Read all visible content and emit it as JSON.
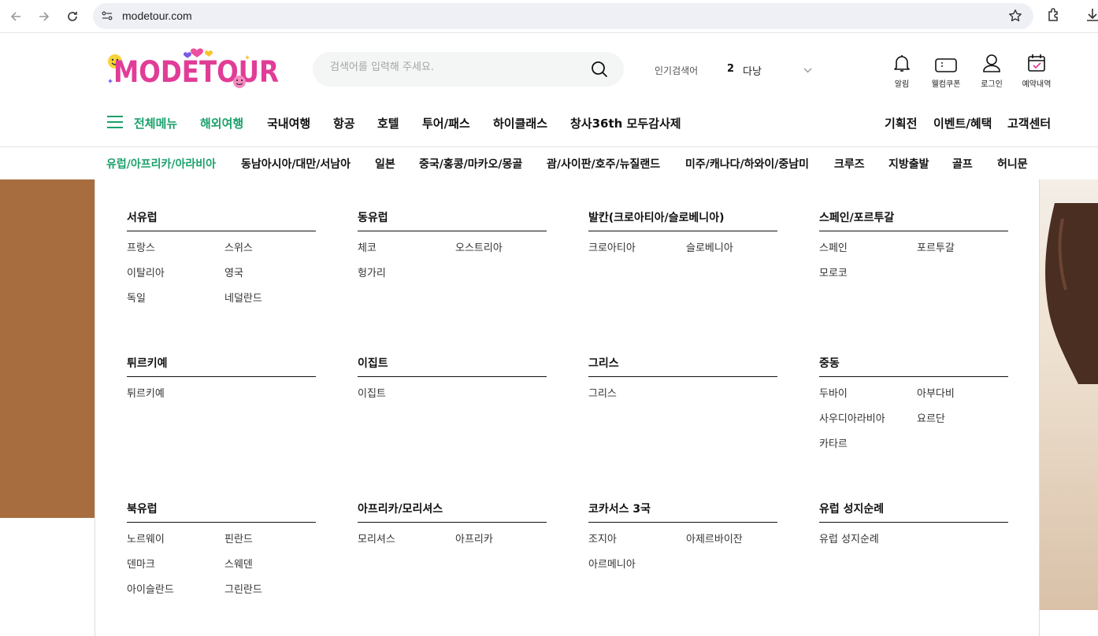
{
  "browser": {
    "url": "modetour.com"
  },
  "header": {
    "logo_text": "MODETOUR",
    "search_placeholder": "검색어를 입력해 주세요.",
    "popular_label": "인기검색어",
    "popular_rank": "2",
    "popular_word": "다낭",
    "utils": [
      {
        "label": "알림",
        "icon": "bell-icon"
      },
      {
        "label": "웰컴쿠폰",
        "icon": "coupon-icon"
      },
      {
        "label": "로그인",
        "icon": "user-icon"
      },
      {
        "label": "예약내역",
        "icon": "calendar-check-icon"
      }
    ]
  },
  "gnb": {
    "all_menu": "전체메뉴",
    "items": [
      "해외여행",
      "국내여행",
      "항공",
      "호텔",
      "투어/패스",
      "하이클래스",
      "창사36th 모두감사제"
    ],
    "right_items": [
      "기획전",
      "이벤트/혜택",
      "고객센터"
    ]
  },
  "subnav": {
    "items": [
      "유럽/아프리카/아라비아",
      "동남아시아/대만/서남아",
      "일본",
      "중국/홍콩/마카오/몽골",
      "괌/사이판/호주/뉴질랜드",
      "미주/캐나다/하와이/중남미",
      "크루즈",
      "지방출발",
      "골프",
      "허니문"
    ]
  },
  "mega_menu": {
    "groups": [
      {
        "title": "서유럽",
        "links": [
          "프랑스",
          "스위스",
          "이탈리아",
          "영국",
          "독일",
          "네덜란드"
        ]
      },
      {
        "title": "동유럽",
        "links": [
          "체코",
          "오스트리아",
          "헝가리"
        ]
      },
      {
        "title": "발칸(크로아티아/슬로베니아)",
        "links": [
          "크로아티아",
          "슬로베니아"
        ]
      },
      {
        "title": "스페인/포르투갈",
        "links": [
          "스페인",
          "포르투갈",
          "모로코"
        ]
      },
      {
        "title": "튀르키예",
        "links": [
          "튀르키예"
        ]
      },
      {
        "title": "이집트",
        "links": [
          "이집트"
        ]
      },
      {
        "title": "그리스",
        "links": [
          "그리스"
        ]
      },
      {
        "title": "중동",
        "links": [
          "두바이",
          "아부다비",
          "사우디아라비아",
          "요르단",
          "카타르"
        ]
      },
      {
        "title": "북유럽",
        "links": [
          "노르웨이",
          "핀란드",
          "덴마크",
          "스웨덴",
          "아이슬란드",
          "그린란드"
        ]
      },
      {
        "title": "아프리카/모리셔스",
        "links": [
          "모리셔스",
          "아프리카"
        ]
      },
      {
        "title": "코카서스 3국",
        "links": [
          "조지아",
          "아제르바이잔",
          "아르메니아"
        ]
      },
      {
        "title": "유럽 성지순례",
        "links": [
          "유럽 성지순례"
        ]
      }
    ]
  },
  "colors": {
    "accent": "#1aa16b",
    "banner_brown": "#a86d3e"
  }
}
